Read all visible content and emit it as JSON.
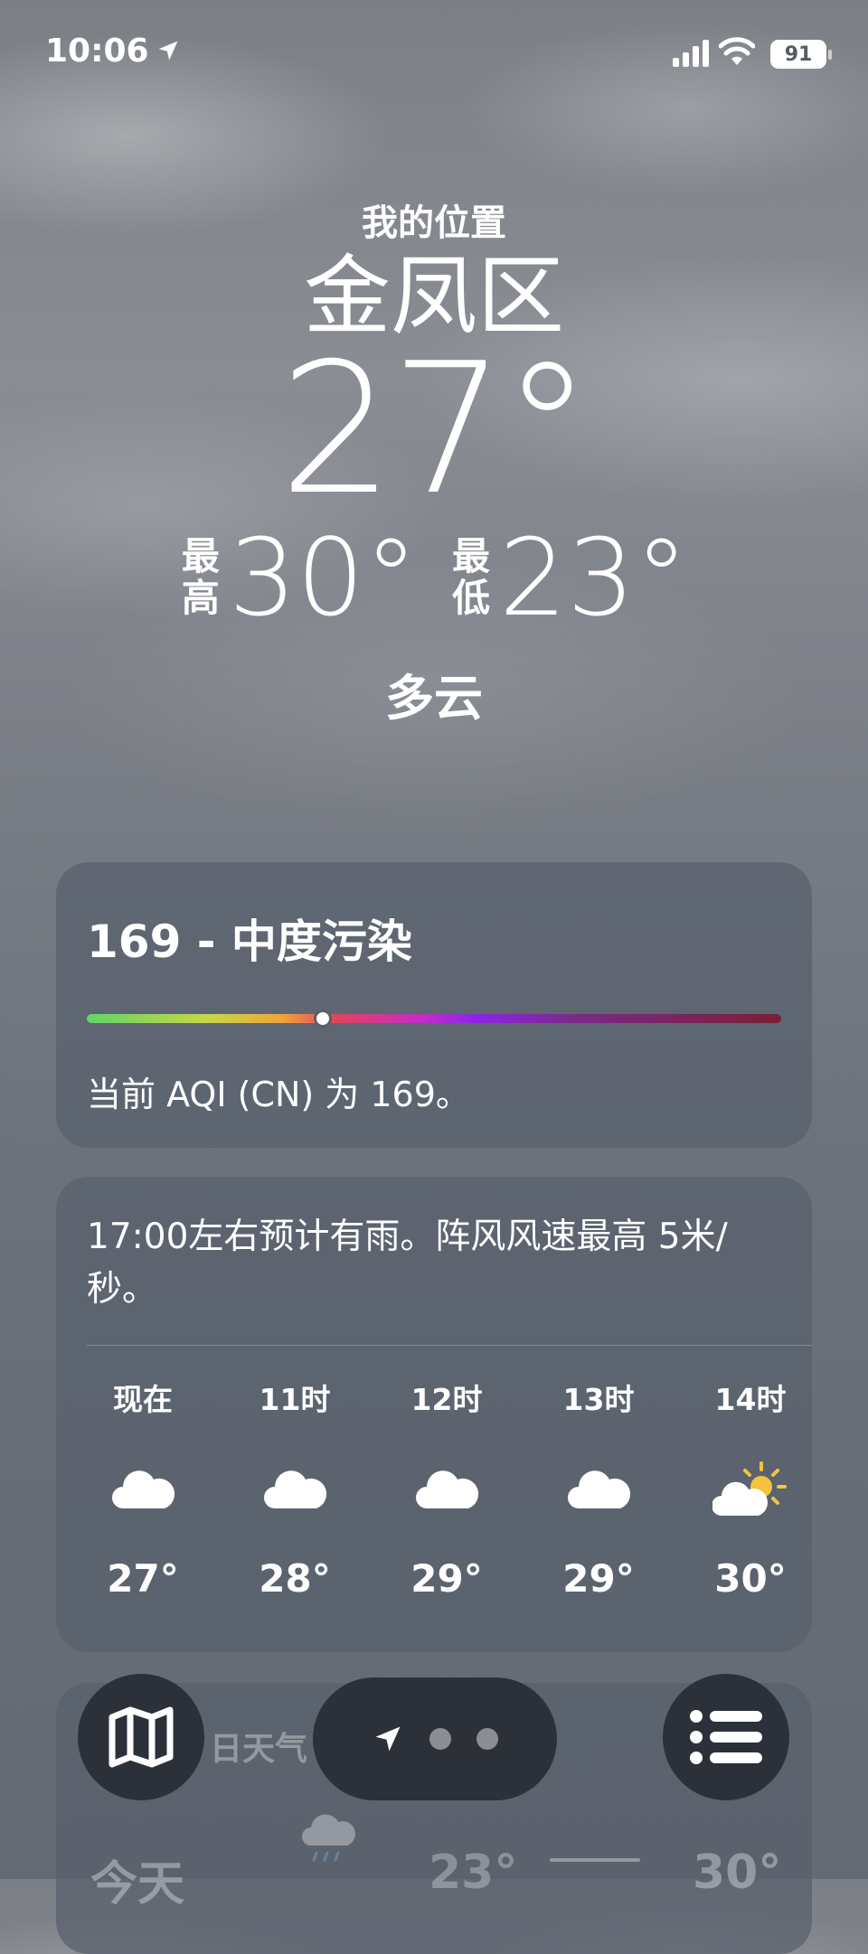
{
  "status_bar": {
    "time": "10:06",
    "battery": "91"
  },
  "location": {
    "label": "我的位置",
    "city": "金凤区"
  },
  "current": {
    "temp": "27°",
    "high_label": "最高",
    "high": "30°",
    "low_label": "最低",
    "low": "23°",
    "condition": "多云"
  },
  "aqi": {
    "title": "169 - 中度污染",
    "value": 169,
    "bar_position": 0.34,
    "description": "当前 AQI (CN) 为 169。"
  },
  "hourly": {
    "summary": "17:00左右预计有雨。阵风风速最高 5米/秒。",
    "items": [
      {
        "label": "现在",
        "icon": "cloud-icon",
        "temp": "27°"
      },
      {
        "label": "11时",
        "icon": "cloud-icon",
        "temp": "28°"
      },
      {
        "label": "12时",
        "icon": "cloud-icon",
        "temp": "29°"
      },
      {
        "label": "13时",
        "icon": "cloud-icon",
        "temp": "29°"
      },
      {
        "label": "14时",
        "icon": "partly-sunny-icon",
        "temp": "30°"
      }
    ]
  },
  "daily": {
    "title": "日天气",
    "today": "今天",
    "low": "23°",
    "high": "30°"
  },
  "toolbar": {
    "map": "map-icon",
    "location": "location-arrow-icon",
    "list": "list-icon"
  },
  "colors": {
    "card_bg": "#58606c",
    "toolbar_bg": "#2b3039"
  }
}
